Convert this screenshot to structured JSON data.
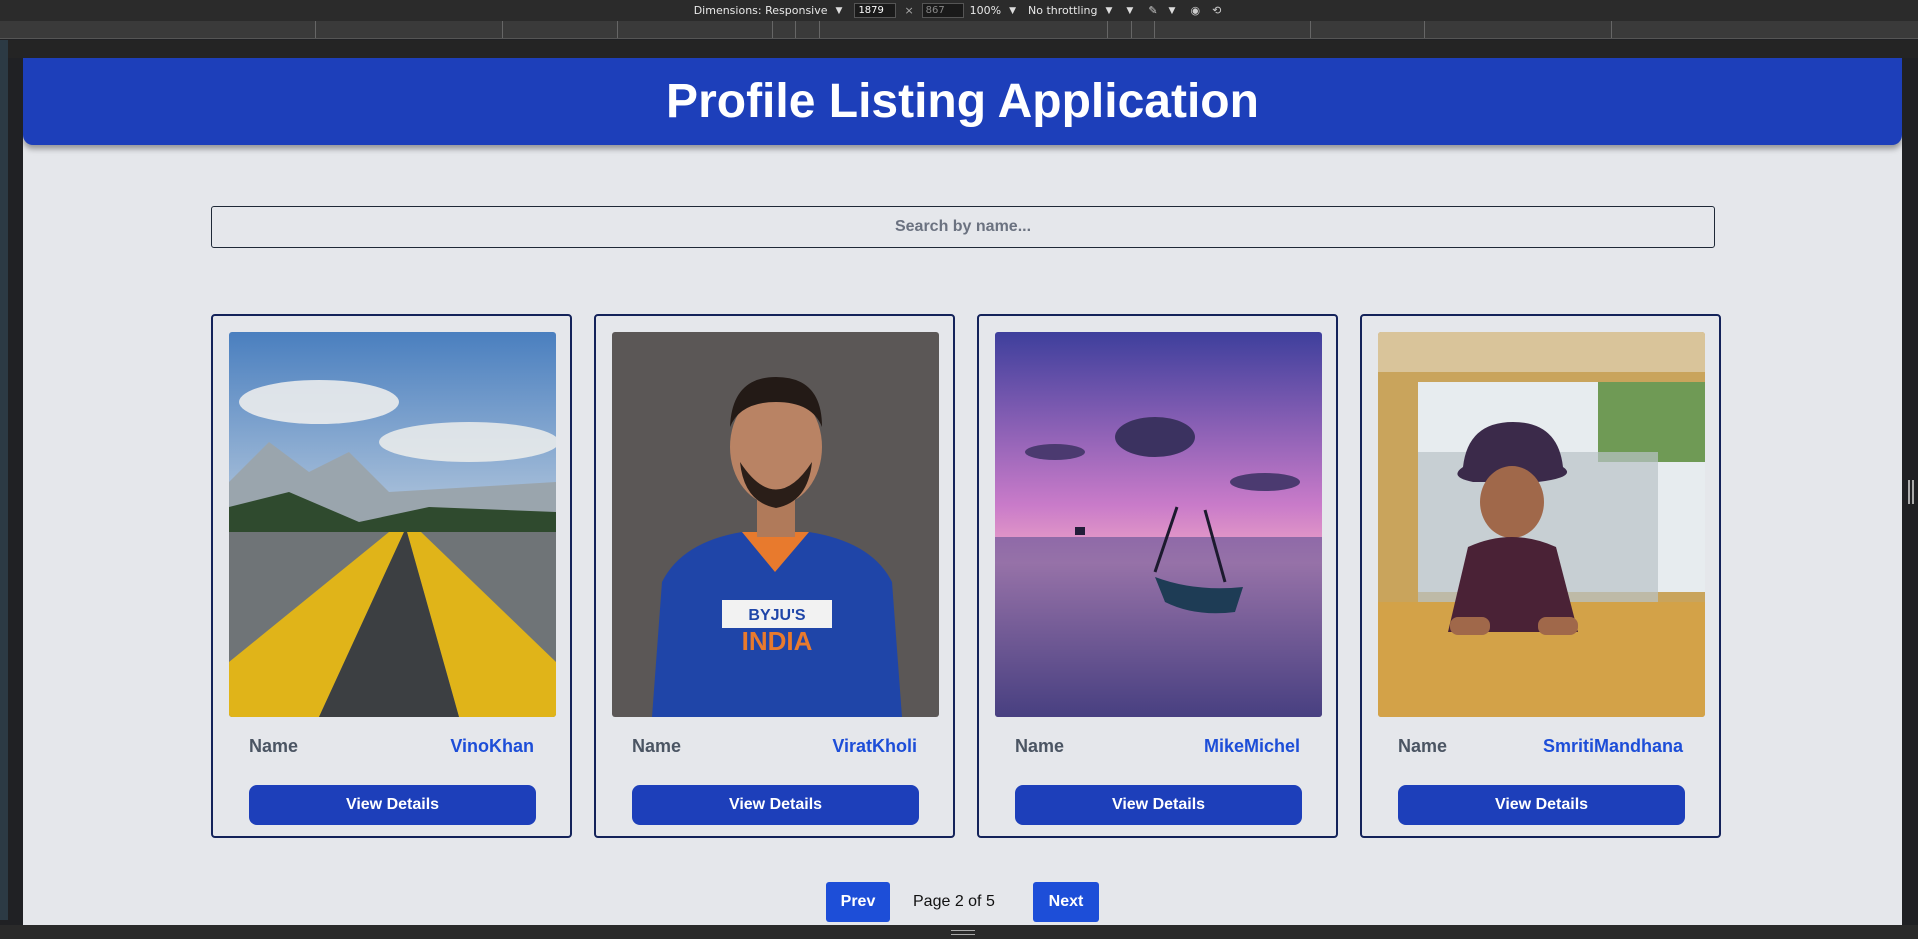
{
  "devtools": {
    "dimensions_label": "Dimensions: Responsive",
    "width": "1879",
    "height": "867",
    "zoom": "100%",
    "throttling": "No throttling",
    "times": "×"
  },
  "header": {
    "title": "Profile Listing Application"
  },
  "search": {
    "placeholder": "Search by name..."
  },
  "profiles": [
    {
      "name_label": "Name",
      "name": "VinoKhan",
      "button_label": "View Details",
      "photo": "road-landscape"
    },
    {
      "name_label": "Name",
      "name": "ViratKholi",
      "button_label": "View Details",
      "photo": "cricketer-portrait"
    },
    {
      "name_label": "Name",
      "name": "MikeMichel",
      "button_label": "View Details",
      "photo": "sunset-boat"
    },
    {
      "name_label": "Name",
      "name": "SmritiMandhana",
      "button_label": "View Details",
      "photo": "child-in-car"
    }
  ],
  "pagination": {
    "prev_label": "Prev",
    "next_label": "Next",
    "page_text": "Page 2 of 5"
  },
  "colors": {
    "header_bg": "#1d3fba",
    "page_bg": "#e5e7eb",
    "button_bg": "#1d3fba",
    "name_value": "#1d4ed8",
    "pager_bg": "#1d4ed8"
  }
}
